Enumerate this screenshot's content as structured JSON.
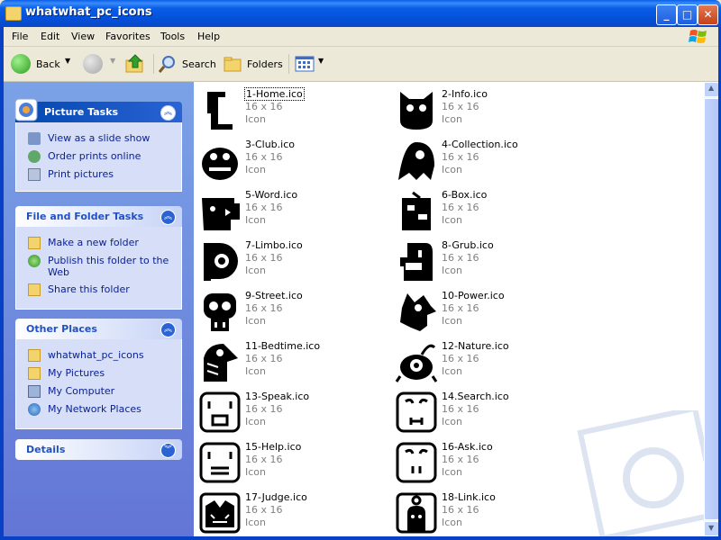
{
  "window": {
    "title": "whatwhat_pc_icons"
  },
  "menu": [
    "File",
    "Edit",
    "View",
    "Favorites",
    "Tools",
    "Help"
  ],
  "toolbar": {
    "back": "Back",
    "search": "Search",
    "folders": "Folders"
  },
  "panels": {
    "picture_tasks": {
      "title": "Picture Tasks",
      "items": [
        "View as a slide show",
        "Order prints online",
        "Print pictures"
      ]
    },
    "file_folder_tasks": {
      "title": "File and Folder Tasks",
      "items": [
        "Make a new folder",
        "Publish this folder to the Web",
        "Share this folder"
      ]
    },
    "other_places": {
      "title": "Other Places",
      "items": [
        "whatwhat_pc_icons",
        "My Pictures",
        "My Computer",
        "My Network Places"
      ]
    },
    "details": {
      "title": "Details"
    }
  },
  "files": [
    {
      "name": "1-Home.ico",
      "size": "16 x 16",
      "type": "Icon"
    },
    {
      "name": "2-Info.ico",
      "size": "16 x 16",
      "type": "Icon"
    },
    {
      "name": "3-Club.ico",
      "size": "16 x 16",
      "type": "Icon"
    },
    {
      "name": "4-Collection.ico",
      "size": "16 x 16",
      "type": "Icon"
    },
    {
      "name": "5-Word.ico",
      "size": "16 x 16",
      "type": "Icon"
    },
    {
      "name": "6-Box.ico",
      "size": "16 x 16",
      "type": "Icon"
    },
    {
      "name": "7-Limbo.ico",
      "size": "16 x 16",
      "type": "Icon"
    },
    {
      "name": "8-Grub.ico",
      "size": "16 x 16",
      "type": "Icon"
    },
    {
      "name": "9-Street.ico",
      "size": "16 x 16",
      "type": "Icon"
    },
    {
      "name": "10-Power.ico",
      "size": "16 x 16",
      "type": "Icon"
    },
    {
      "name": "11-Bedtime.ico",
      "size": "16 x 16",
      "type": "Icon"
    },
    {
      "name": "12-Nature.ico",
      "size": "16 x 16",
      "type": "Icon"
    },
    {
      "name": "13-Speak.ico",
      "size": "16 x 16",
      "type": "Icon"
    },
    {
      "name": "14.Search.ico",
      "size": "16 x 16",
      "type": "Icon"
    },
    {
      "name": "15-Help.ico",
      "size": "16 x 16",
      "type": "Icon"
    },
    {
      "name": "16-Ask.ico",
      "size": "16 x 16",
      "type": "Icon"
    },
    {
      "name": "17-Judge.ico",
      "size": "16 x 16",
      "type": "Icon"
    },
    {
      "name": "18-Link.ico",
      "size": "16 x 16",
      "type": "Icon"
    }
  ],
  "colors": {
    "titlebar": "#0a5ee8",
    "task_link": "#0c2196",
    "left_pane": "#7ba2e7"
  }
}
